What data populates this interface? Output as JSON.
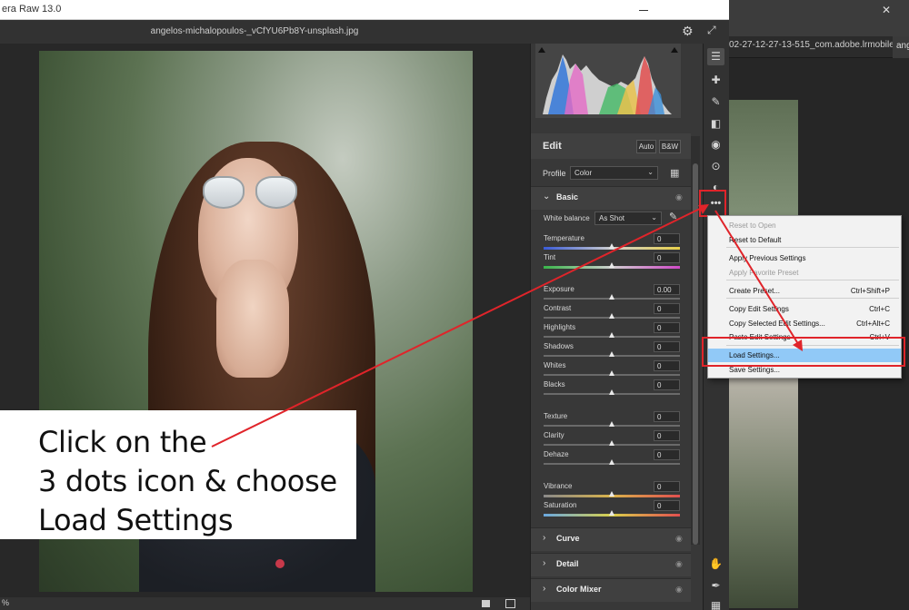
{
  "window": {
    "title": "era Raw 13.0",
    "filename": "angelos-michalopoulos-_vCfYU6Pb8Y-unsplash.jpg"
  },
  "background_tabs": {
    "tab1": "02-27-12-27-13-515_com.adobe.lrmobile.jpg",
    "tab1_close": "×",
    "tab2": "ang",
    "window_close": "✕"
  },
  "icons": {
    "gear": "⚙",
    "expand": "⤢"
  },
  "status": {
    "zoom": "%"
  },
  "edit": {
    "title": "Edit",
    "auto_label": "Auto",
    "bw_label": "B&W"
  },
  "profile": {
    "label": "Profile",
    "value": "Color"
  },
  "basic": {
    "title": "Basic",
    "white_balance_label": "White balance",
    "white_balance_value": "As Shot",
    "sliders": [
      {
        "label": "Temperature",
        "value": "0",
        "pos": 0.5
      },
      {
        "label": "Tint",
        "value": "0",
        "pos": 0.5
      },
      {
        "label": "Exposure",
        "value": "0.00",
        "pos": 0.5
      },
      {
        "label": "Contrast",
        "value": "0",
        "pos": 0.5
      },
      {
        "label": "Highlights",
        "value": "0",
        "pos": 0.5
      },
      {
        "label": "Shadows",
        "value": "0",
        "pos": 0.5
      },
      {
        "label": "Whites",
        "value": "0",
        "pos": 0.5
      },
      {
        "label": "Blacks",
        "value": "0",
        "pos": 0.5
      },
      {
        "label": "Texture",
        "value": "0",
        "pos": 0.5
      },
      {
        "label": "Clarity",
        "value": "0",
        "pos": 0.5
      },
      {
        "label": "Dehaze",
        "value": "0",
        "pos": 0.5
      },
      {
        "label": "Vibrance",
        "value": "0",
        "pos": 0.5
      },
      {
        "label": "Saturation",
        "value": "0",
        "pos": 0.5
      }
    ]
  },
  "sections": {
    "curve": "Curve",
    "detail": "Detail",
    "color_mixer": "Color Mixer"
  },
  "menu": {
    "items": [
      {
        "label": "Reset to Open",
        "shortcut": "",
        "disabled": true
      },
      {
        "label": "Reset to Default",
        "shortcut": "",
        "disabled": false
      },
      {
        "label": "Apply Previous Settings",
        "shortcut": "",
        "disabled": false
      },
      {
        "label": "Apply Favorite Preset",
        "shortcut": "",
        "disabled": true
      },
      {
        "label": "Create Preset...",
        "shortcut": "Ctrl+Shift+P",
        "disabled": false
      },
      {
        "label": "Copy Edit Settings",
        "shortcut": "Ctrl+C",
        "disabled": false
      },
      {
        "label": "Copy Selected Edit Settings...",
        "shortcut": "Ctrl+Alt+C",
        "disabled": false
      },
      {
        "label": "Paste Edit Settings",
        "shortcut": "Ctrl+V",
        "disabled": false
      },
      {
        "label": "Load Settings...",
        "shortcut": "",
        "disabled": false,
        "highlighted": true
      },
      {
        "label": "Save Settings...",
        "shortcut": "",
        "disabled": false
      }
    ]
  },
  "callout": {
    "line1": "Click on the",
    "line2": "3 dots icon & choose",
    "line3": "Load Settings"
  },
  "colors": {
    "annotation_red": "#e0242a",
    "menu_highlight": "#91c9f7",
    "panel_bg": "#383838"
  }
}
